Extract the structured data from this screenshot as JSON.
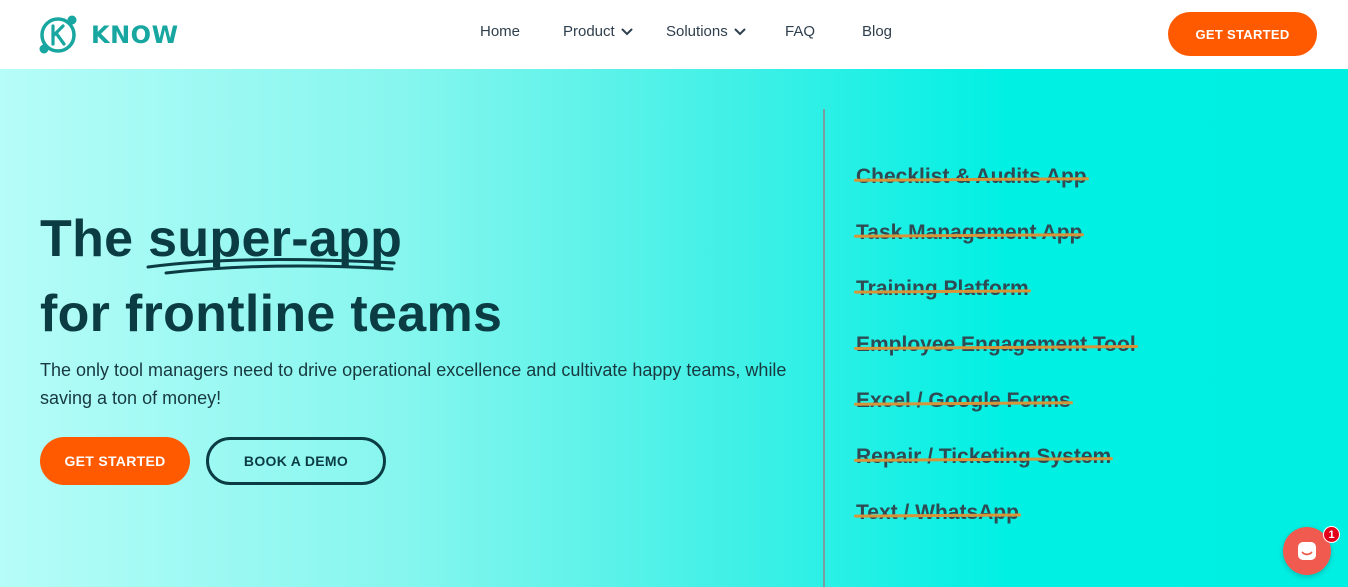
{
  "header": {
    "logo_text": "KNOW",
    "nav": [
      {
        "label": "Home",
        "dropdown": false
      },
      {
        "label": "Product",
        "dropdown": true
      },
      {
        "label": "Solutions",
        "dropdown": true
      },
      {
        "label": "FAQ",
        "dropdown": false
      },
      {
        "label": "Blog",
        "dropdown": false
      }
    ],
    "cta_label": "GET STARTED"
  },
  "hero": {
    "title_part1": "The",
    "title_highlight": "super-app",
    "title_line2": "for frontline teams",
    "subtitle": "The only tool managers need to drive operational excellence and cultivate happy teams, while saving a ton of money!",
    "primary_cta": "GET STARTED",
    "secondary_cta": "BOOK A DEMO",
    "replaced_tools": [
      "Checklist & Audits App",
      "Task Management App",
      "Training Platform",
      "Employee Engagement Tool",
      "Excel / Google Forms",
      "Repair / Ticketing System",
      "Text / WhatsApp"
    ]
  },
  "chat": {
    "icon": "chat-icon",
    "badge_count": "1"
  },
  "colors": {
    "accent": "#ff5a00",
    "brand": "#17a6a0",
    "dark_text": "#0b3c43",
    "strike": "#d7953a",
    "chat": "#f15a4f"
  }
}
